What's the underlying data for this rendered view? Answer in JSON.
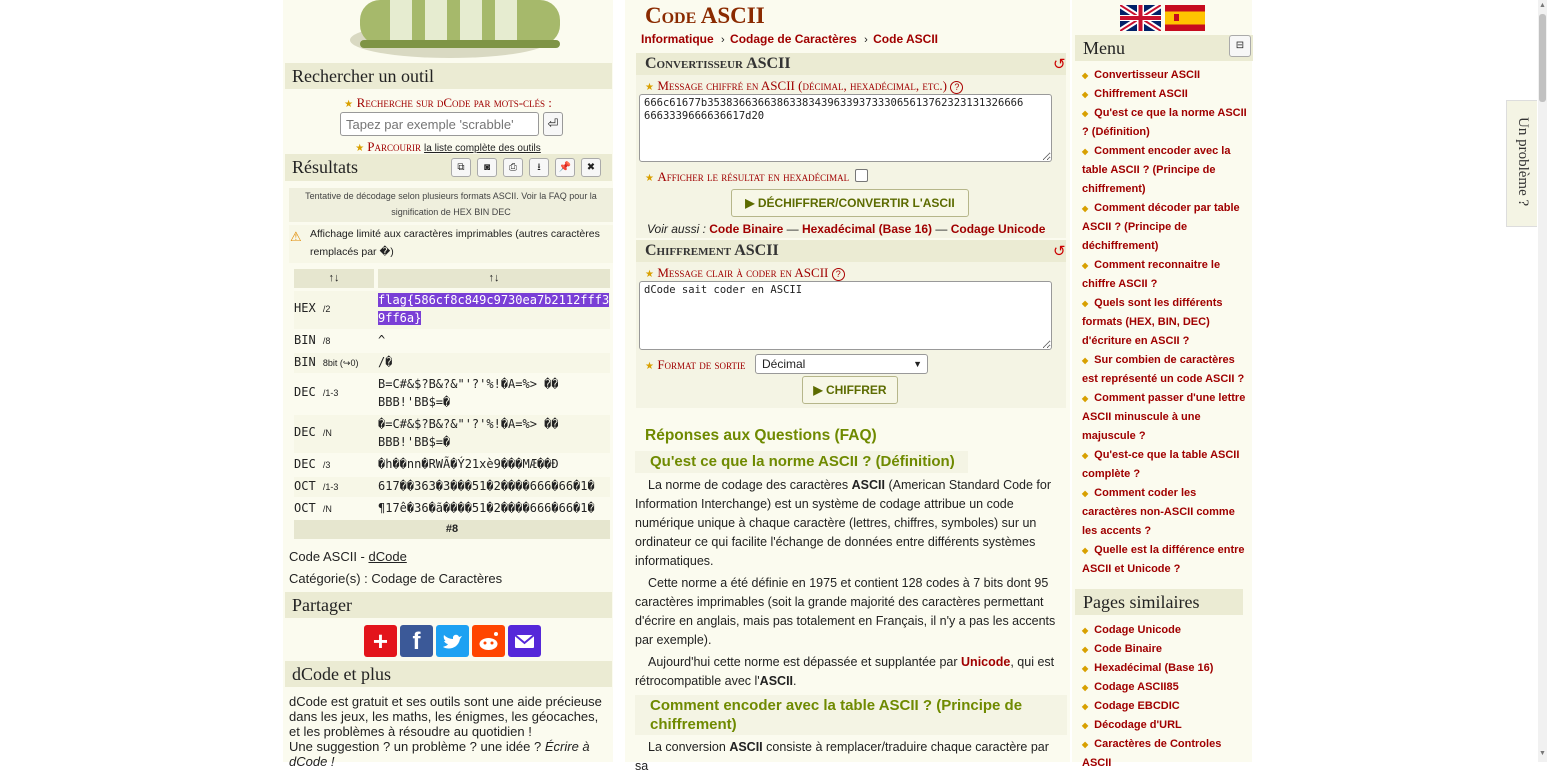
{
  "title": "Code ASCII",
  "breadcrumb": [
    "Informatique",
    "Codage de Caractères",
    "Code ASCII"
  ],
  "left": {
    "search_heading": "Rechercher un outil",
    "search_label": "Recherche sur dCode par mots-clés :",
    "search_placeholder": "Tapez par exemple 'scrabble'",
    "search_go": "⏎",
    "browse_prefix": "Parcourir",
    "browse_link": "la liste complète des outils",
    "results_heading": "Résultats",
    "results_info": "Tentative de décodage selon plusieurs formats ASCII. Voir la FAQ pour la signification de HEX BIN DEC",
    "results_warning": "Affichage limité aux caractères imprimables (autres caractères remplacés par �)",
    "sort_col1": "↑↓",
    "sort_col2": "↑↓",
    "rows": [
      {
        "label": "HEX",
        "sub": "/2",
        "value": "flag{586cf8c849c9730ea7b2112fff39ff6a}"
      },
      {
        "label": "BIN",
        "sub": "/8",
        "value": "^"
      },
      {
        "label": "BIN",
        "sub": "8bit (↪0)",
        "value": "/�"
      },
      {
        "label": "DEC",
        "sub": "/1-3",
        "value": "B=C#&$?B&?&\"'?'%!�A=%> ��\nBBB!'BB$=�"
      },
      {
        "label": "DEC",
        "sub": "/N",
        "value": "�=C#&$?B&?&\"'?'%!�A=%> ��\nBBB!'BB$=�"
      },
      {
        "label": "DEC",
        "sub": "/3",
        "value": "�h��nn�RWÃ�Ý21xè9���MÆ��Ð"
      },
      {
        "label": "OCT",
        "sub": "/1-3",
        "value": "617��363�3���51�2����666�66�1�"
      },
      {
        "label": "OCT",
        "sub": "/N",
        "value": "¶17ê�36�ã����51�2����666�66�1�"
      }
    ],
    "row_count": "#8",
    "credit_prefix": "Code ASCII - ",
    "credit_link": "dCode",
    "category_text": "Catégorie(s) : Codage de Caractères",
    "share_heading": "Partager",
    "more_heading": "dCode et plus",
    "more_text": "dCode est gratuit et ses outils sont une aide précieuse dans les jeux, les maths, les énigmes, les géocaches, et les problèmes à résoudre au quotidien !",
    "more_text2": "Une suggestion ? un problème ? une idée ?",
    "more_link": "Écrire à dCode !"
  },
  "converter": {
    "heading": "Convertisseur ASCII",
    "input_label": "Message chiffré en ASCII (décimal, hexadécimal, etc.)",
    "input_value": "666c61677b35383663663863383439633937333065613762323131326666 6663339666636617d20",
    "hex_option_label": "Afficher le résultat en hexadécimal",
    "button": "▶ DÉCHIFFRER/CONVERTIR L'ASCII",
    "see_also_prefix": "Voir aussi :",
    "see_also": [
      "Code Binaire",
      "Hexadécimal (Base 16)",
      "Codage Unicode"
    ]
  },
  "cipher": {
    "heading": "Chiffrement ASCII",
    "input_label": "Message clair à coder en ASCII",
    "input_value": "dCode sait coder en ASCII",
    "format_label": "Format de sortie",
    "format_value": "Décimal",
    "button": "▶ CHIFFRER"
  },
  "faq": {
    "heading": "Réponses aux Questions (FAQ)",
    "q1": "Qu'est ce que la norme ASCII ? (Définition)",
    "p1a": "La norme de codage des caractères",
    "p1b": "ASCII",
    "p1c": "(American Standard Code for Information Interchange) est un système de codage attribue un code numérique unique à chaque caractère (lettres, chiffres, symboles) sur un ordinateur ce qui facilite l'échange de données entre différents systèmes informatiques.",
    "p2": "Cette norme a été définie en 1975 et contient 128 codes à 7 bits dont 95 caractères imprimables (soit la grande majorité des caractères permettant d'écrire en anglais, mais pas totalement en Français, il n'y a pas les accents par exemple).",
    "p3a": "Aujourd'hui cette norme est dépassée et supplantée par",
    "p3link": "Unicode",
    "p3b": ", qui est rétrocompatible avec l'",
    "p3c": "ASCII",
    "q2": "Comment encoder avec la table ASCII ? (Principe de chiffrement)",
    "p4a": "La conversion",
    "p4b": "ASCII",
    "p4c": "consiste à remplacer/traduire chaque caractère par sa"
  },
  "menu": {
    "heading": "Menu",
    "items": [
      "Convertisseur ASCII",
      "Chiffrement ASCII",
      "Qu'est ce que la norme ASCII ? (Définition)",
      "Comment encoder avec la table ASCII ? (Principe de chiffrement)",
      "Comment décoder par table ASCII ? (Principe de déchiffrement)",
      "Comment reconnaitre le chiffre ASCII ?",
      "Quels sont les différents formats (HEX, BIN, DEC) d'écriture en ASCII ?",
      "Sur combien de caractères est représenté un code ASCII ?",
      "Comment passer d'une lettre ASCII minuscule à une majuscule ?",
      "Qu'est-ce que la table ASCII complète ?",
      "Comment coder les caractères non-ASCII comme les accents ?",
      "Quelle est la différence entre ASCII et Unicode ?"
    ],
    "similar_heading": "Pages similaires",
    "similar": [
      "Codage Unicode",
      "Code Binaire",
      "Hexadécimal (Base 16)",
      "Codage ASCII85",
      "Codage EBCDIC",
      "Décodage d'URL",
      "Caractères de Controles ASCII"
    ]
  },
  "feedback_tab": "Un problème ?",
  "colors": {
    "accent_red": "#a00000",
    "faq_green": "#6f8a00",
    "panel_bg": "#f4f4e4",
    "highlight": "#7a3fd6"
  }
}
